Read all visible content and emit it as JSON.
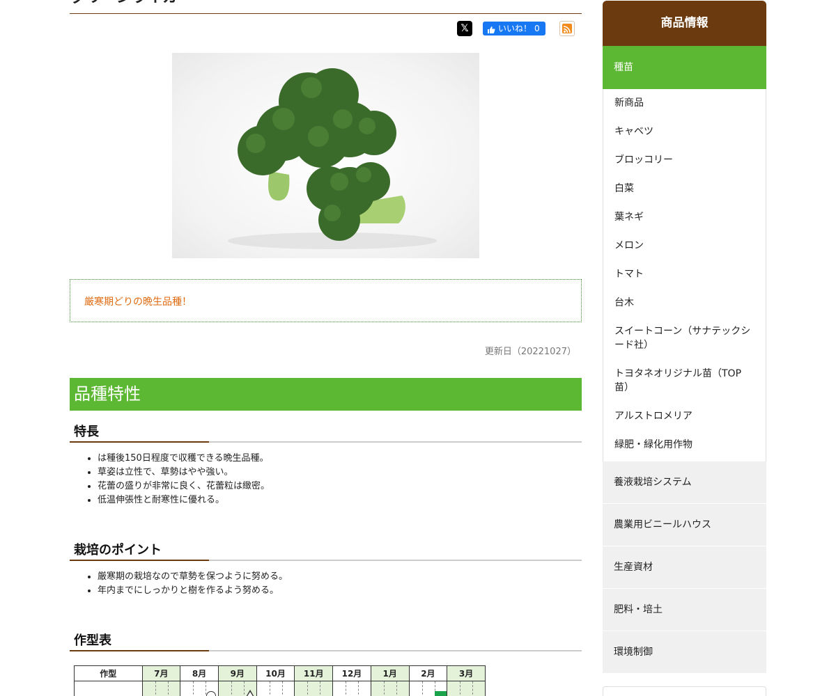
{
  "page": {
    "title_partial": "グリーンライカ"
  },
  "share": {
    "x_label": "𝕏",
    "fb_label": "いいね！",
    "fb_count": "0",
    "x_icon": "x-logo-icon",
    "fb_icon": "thumbs-up-icon",
    "rss_icon": "rss-icon"
  },
  "catch_copy": "厳寒期どりの晩生品種！",
  "updated": "更新日（20221027）",
  "section_title": "品種特性",
  "features": {
    "heading": "特長",
    "items": [
      "は種後150日程度で収穫できる晩生品種。",
      "草姿は立性で、草勢はやや強い。",
      "花蕾の盛りが非常に良く、花蕾粒は緻密。",
      "低温伸張性と耐寒性に優れる。"
    ]
  },
  "points": {
    "heading": "栽培のポイント",
    "items": [
      "厳寒期の栽培なので草勢を保つように努める。",
      "年内までにしっかりと樹を作るよう努める。"
    ]
  },
  "schedule": {
    "heading": "作型表",
    "first_col": "作型",
    "months": [
      "7月",
      "8月",
      "9月",
      "10月",
      "11月",
      "12月",
      "1月",
      "2月",
      "3月"
    ]
  },
  "sidebar": {
    "title": "商品情報",
    "active_category": "種苗",
    "sub_items": [
      "新商品",
      "キャベツ",
      "ブロッコリー",
      "白菜",
      "葉ネギ",
      "メロン",
      "トマト",
      "台木",
      "スイートコーン（サナテックシード社）",
      "トヨタネオリジナル苗（TOP苗）",
      "アルストロメリア",
      "緑肥・緑化用作物"
    ],
    "categories": [
      "養液栽培システム",
      "農業用ビニールハウス",
      "生産資材",
      "肥料・培土",
      "環境制御"
    ]
  },
  "colors": {
    "brown": "#6b3a0f",
    "green": "#5cb832",
    "accent_orange": "#e06a10",
    "calendar_green": "#1aa34a"
  }
}
